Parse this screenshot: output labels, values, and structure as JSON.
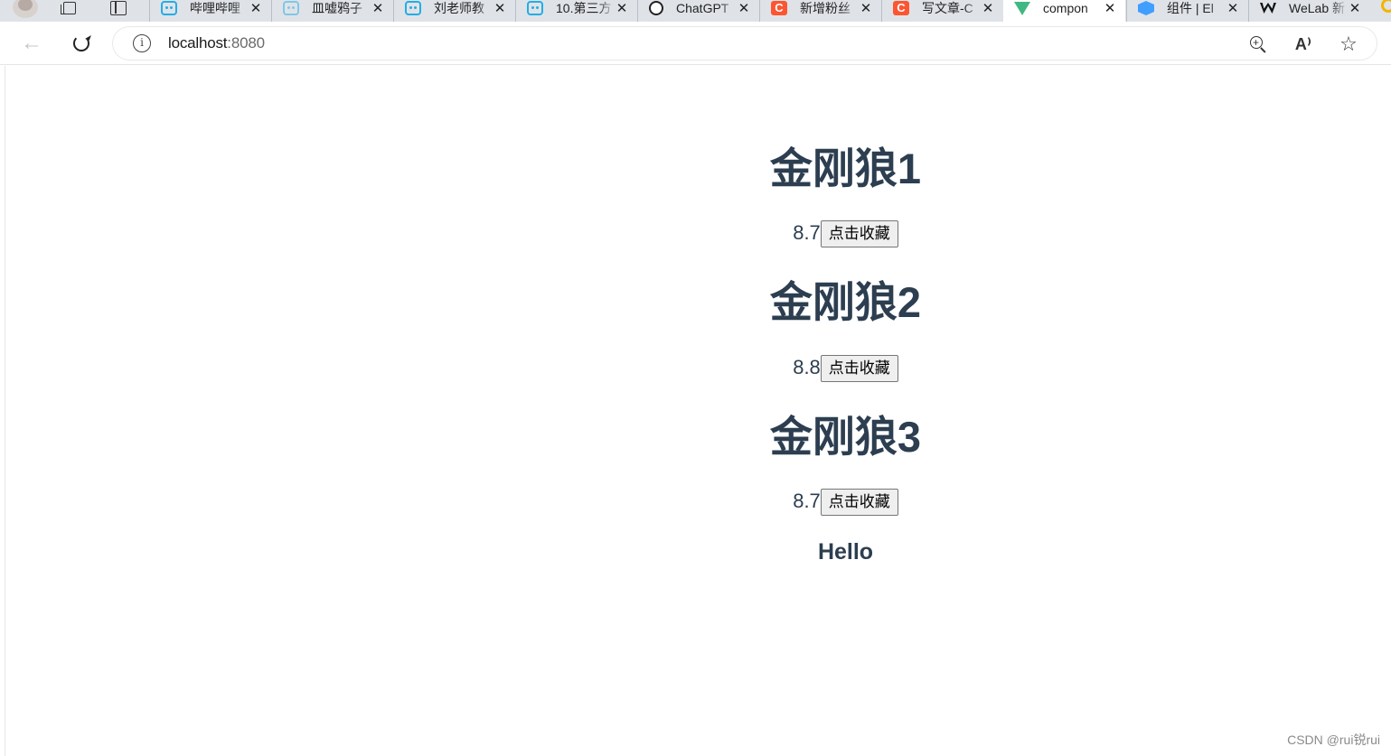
{
  "browser": {
    "tabs": [
      {
        "label": "哔哩哔哩",
        "icon": "bilibili-icon",
        "active": false
      },
      {
        "label": "皿嘘鸦子",
        "icon": "bilibili-icon",
        "active": false
      },
      {
        "label": "刘老师教",
        "icon": "bilibili-icon",
        "active": false
      },
      {
        "label": "10.第三方",
        "icon": "bilibili-icon",
        "active": false
      },
      {
        "label": "ChatGPT",
        "icon": "openai-icon",
        "active": false
      },
      {
        "label": "新增粉丝",
        "icon": "csdn-icon",
        "active": false
      },
      {
        "label": "写文章-C",
        "icon": "csdn-icon",
        "active": false
      },
      {
        "label": "compon",
        "icon": "vue-icon",
        "active": true
      },
      {
        "label": "组件 | El",
        "icon": "element-icon",
        "active": false
      },
      {
        "label": "WeLab 新",
        "icon": "welab-icon",
        "active": false
      }
    ],
    "close_glyph": "✕",
    "address": {
      "host": "localhost",
      "port": ":8080"
    }
  },
  "movies": [
    {
      "title": "金刚狼1",
      "score": "8.7",
      "button_label": "点击收藏"
    },
    {
      "title": "金刚狼2",
      "score": "8.8",
      "button_label": "点击收藏"
    },
    {
      "title": "金刚狼3",
      "score": "8.7",
      "button_label": "点击收藏"
    }
  ],
  "hello": "Hello",
  "watermark": "CSDN @rui锐rui"
}
